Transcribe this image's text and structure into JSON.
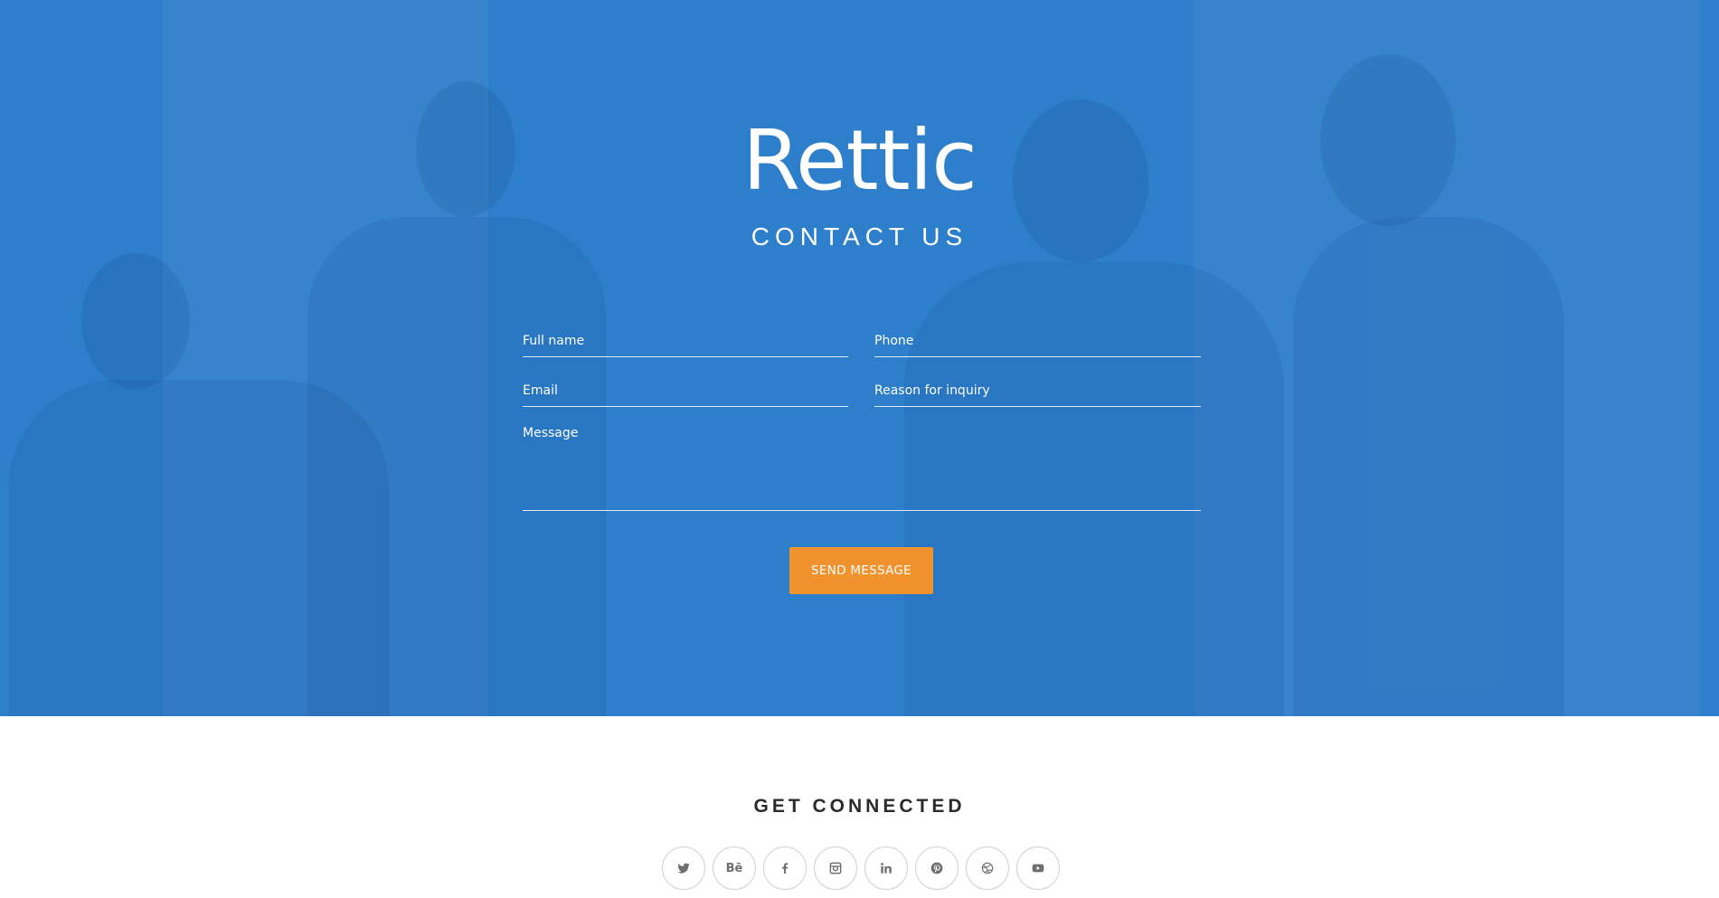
{
  "hero": {
    "brand": "Rettic",
    "subtitle": "CONTACT US",
    "background_color": "#2d7ecb"
  },
  "form": {
    "full_name_placeholder": "Full name",
    "phone_placeholder": "Phone",
    "email_placeholder": "Email",
    "reason_placeholder": "Reason for inquiry",
    "message_placeholder": "Message",
    "submit_label": "SEND MESSAGE",
    "submit_color": "#f0922d"
  },
  "footer": {
    "title": "GET CONNECTED",
    "social": [
      {
        "icon": "twitter-icon"
      },
      {
        "icon": "behance-icon",
        "glyph": "Bē"
      },
      {
        "icon": "facebook-icon"
      },
      {
        "icon": "instagram-icon"
      },
      {
        "icon": "linkedin-icon"
      },
      {
        "icon": "pinterest-icon"
      },
      {
        "icon": "dribbble-icon"
      },
      {
        "icon": "youtube-icon"
      }
    ]
  }
}
